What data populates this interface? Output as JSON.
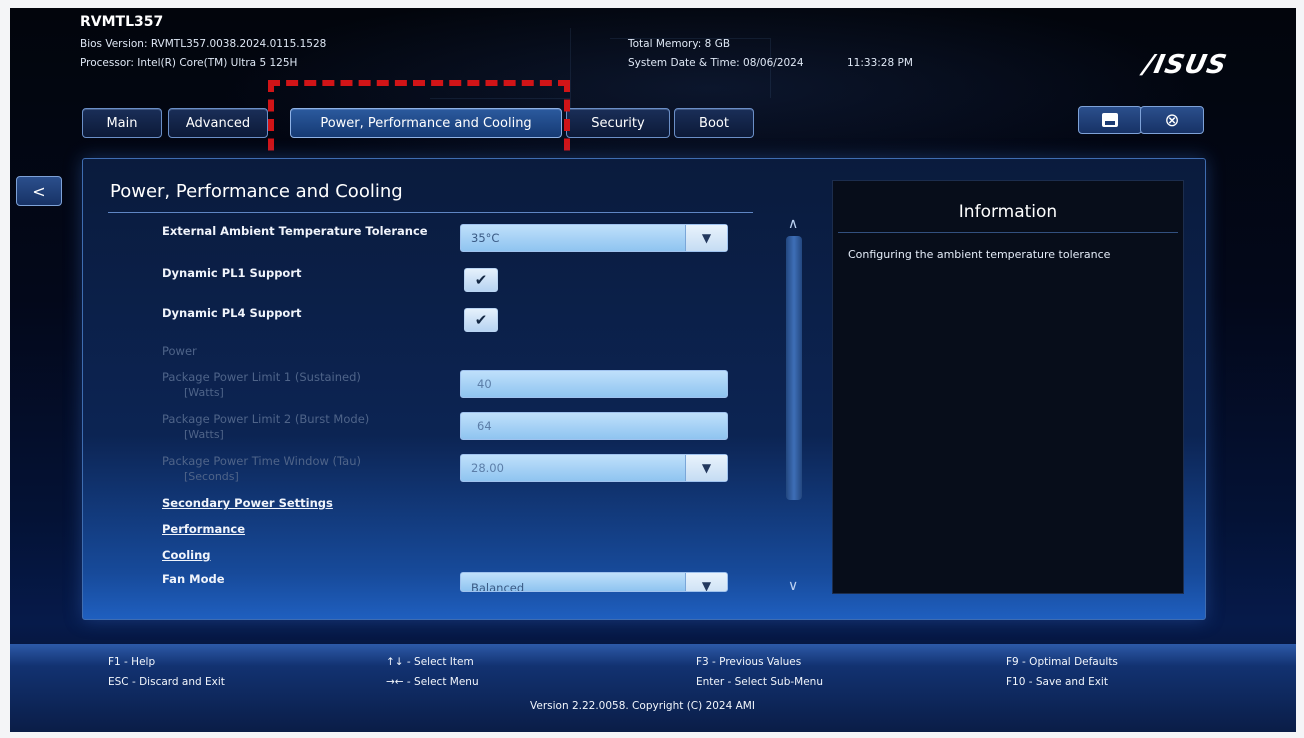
{
  "header": {
    "model": "RVMTL357",
    "bios_version": "Bios Version:  RVMTL357.0038.2024.0115.1528",
    "processor": "Processor:  Intel(R) Core(TM) Ultra 5 125H",
    "total_memory": "Total Memory:  8 GB",
    "system_datetime": "System Date & Time:  08/06/2024",
    "time": "11:33:28 PM",
    "brand": "/ISUS"
  },
  "tabs": [
    {
      "label": "Main",
      "active": false
    },
    {
      "label": "Advanced",
      "active": false
    },
    {
      "label": "Power, Performance and Cooling",
      "active": true
    },
    {
      "label": "Security",
      "active": false
    },
    {
      "label": "Boot",
      "active": false
    }
  ],
  "toolbar": {
    "save_icon": "save-icon",
    "exit_icon": "close-circle-icon",
    "back_label": "<"
  },
  "panel": {
    "title": "Power, Performance and Cooling",
    "settings": {
      "ambient_label": "External Ambient Temperature Tolerance",
      "ambient_value": "35°C",
      "pl1_label": "Dynamic PL1 Support",
      "pl1_checked": true,
      "pl4_label": "Dynamic PL4 Support",
      "pl4_checked": true,
      "power_section": "Power",
      "pl1_limit_label": "Package Power Limit 1 (Sustained)",
      "pl1_limit_unit": "[Watts]",
      "pl1_limit_value": "40",
      "pl2_limit_label": "Package Power Limit 2 (Burst Mode)",
      "pl2_limit_unit": "[Watts]",
      "pl2_limit_value": "64",
      "tau_label": "Package Power Time Window (Tau)",
      "tau_unit": "[Seconds]",
      "tau_value": "28.00",
      "secondary_link": "Secondary Power Settings",
      "performance_link": "Performance",
      "cooling_link": "Cooling",
      "fan_mode_label": "Fan Mode",
      "fan_mode_value": "Balanced"
    }
  },
  "info": {
    "title": "Information",
    "text": "Configuring the ambient temperature tolerance"
  },
  "footer": {
    "f1": "F1 - Help",
    "esc": "ESC - Discard and Exit",
    "select_item": "↑↓ - Select Item",
    "select_menu": "→← - Select Menu",
    "f3": "F3 - Previous Values",
    "enter": "Enter - Select Sub-Menu",
    "f9": "F9 - Optimal Defaults",
    "f10": "F10 - Save and Exit",
    "version": "Version 2.22.0058. Copyright (C) 2024 AMI"
  }
}
